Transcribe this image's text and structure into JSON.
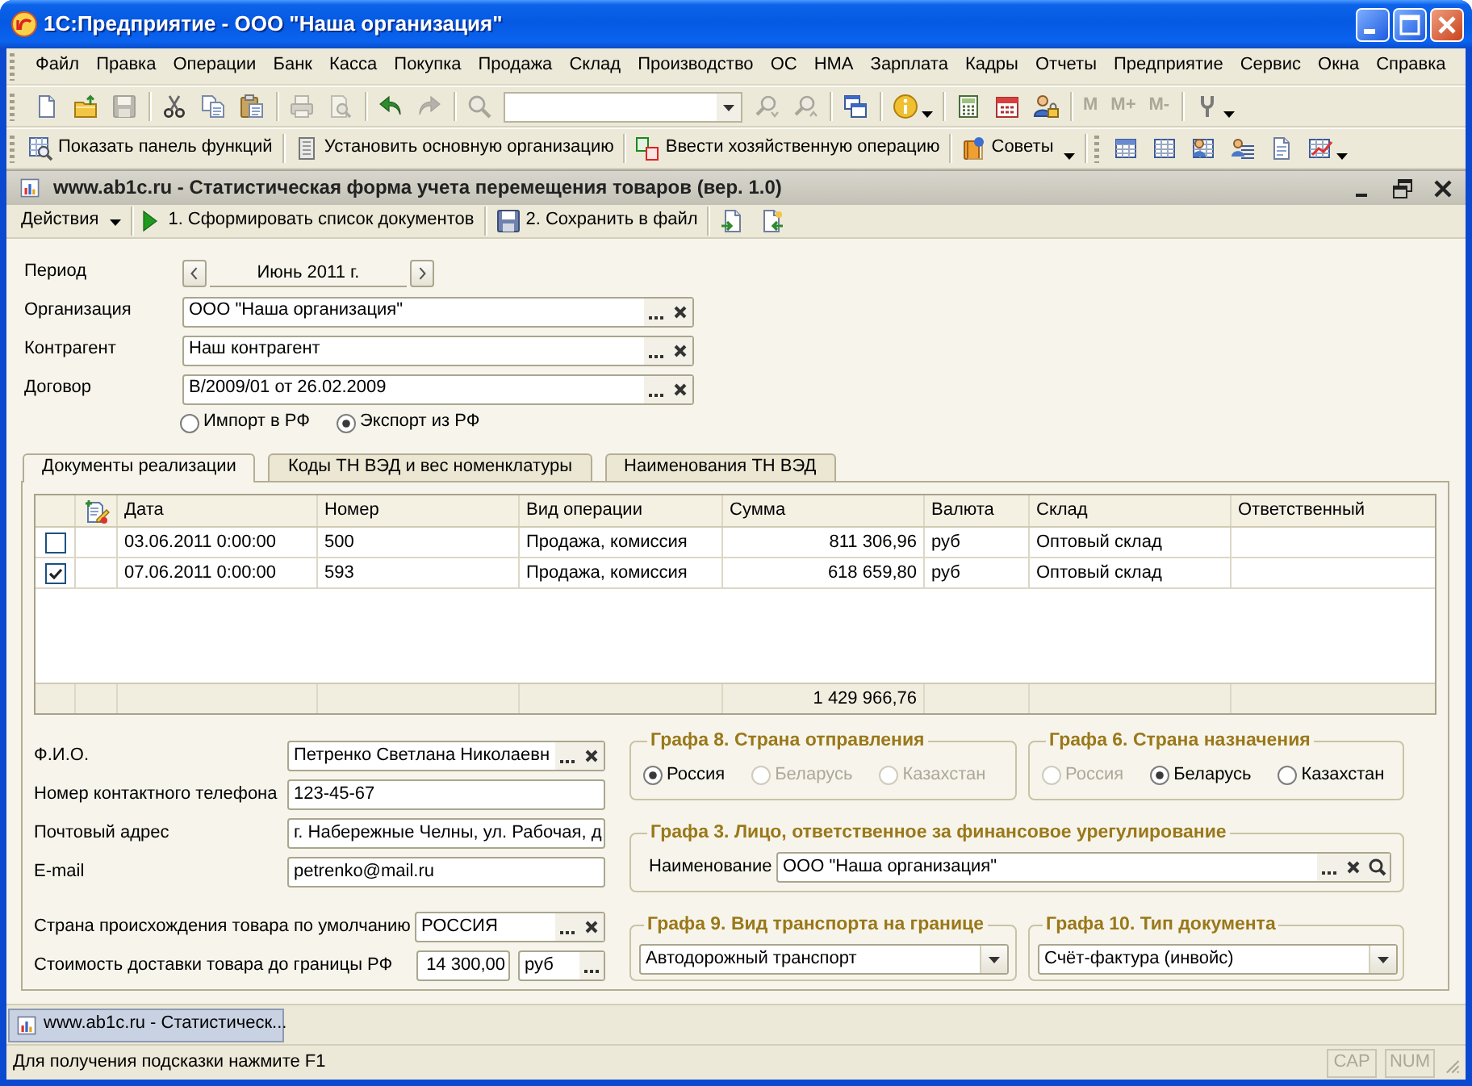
{
  "window": {
    "title": "1С:Предприятие - ООО \"Наша организация\""
  },
  "menu": [
    "Файл",
    "Правка",
    "Операции",
    "Банк",
    "Касса",
    "Покупка",
    "Продажа",
    "Склад",
    "Производство",
    "ОС",
    "НМА",
    "Зарплата",
    "Кадры",
    "Отчеты",
    "Предприятие",
    "Сервис",
    "Окна",
    "Справка"
  ],
  "toolbar": {
    "groups": [
      [
        {
          "kind": "icon",
          "disabled": false
        },
        {
          "kind": "icon",
          "disabled": false
        },
        {
          "kind": "icon",
          "disabled": true
        }
      ],
      [
        {
          "kind": "icon",
          "disabled": false
        },
        {
          "kind": "icon",
          "disabled": false
        },
        {
          "kind": "icon",
          "disabled": false
        }
      ],
      [
        {
          "kind": "icon",
          "disabled": true
        },
        {
          "kind": "icon",
          "disabled": true
        }
      ],
      [
        {
          "kind": "icon",
          "disabled": false
        },
        {
          "kind": "icon",
          "disabled": true
        }
      ],
      [
        {
          "kind": "icon",
          "disabled": true
        },
        {
          "kind": "combo"
        },
        {
          "kind": "icon",
          "disabled": true
        },
        {
          "kind": "icon",
          "disabled": true
        }
      ],
      [
        {
          "kind": "icon",
          "disabled": false
        }
      ],
      [
        {
          "kind": "icon",
          "disabled": false
        },
        {
          "kind": "caret"
        }
      ],
      [
        {
          "kind": "icon",
          "disabled": false
        },
        {
          "kind": "icon",
          "disabled": false
        },
        {
          "kind": "icon",
          "disabled": false
        }
      ],
      [
        {
          "kind": "text",
          "label": "M",
          "disabled": true
        },
        {
          "kind": "text",
          "label": "M+",
          "disabled": true
        },
        {
          "kind": "text",
          "label": "M-",
          "disabled": true
        }
      ],
      [
        {
          "kind": "icon",
          "disabled": false
        },
        {
          "kind": "caret"
        }
      ]
    ]
  },
  "functions_toolbar": [
    {
      "label": "Показать панель функций",
      "dropdown": false
    },
    {
      "label": "Установить основную организацию",
      "dropdown": false
    },
    {
      "label": "Ввести хозяйственную операцию",
      "dropdown": false
    },
    {
      "label": "Советы",
      "dropdown": true
    }
  ],
  "document_window": {
    "title": "www.ab1c.ru - Статистическая форма учета перемещения товаров (вер. 1.0)"
  },
  "form_toolbar": {
    "actions": "Действия",
    "buttons": [
      "1. Сформировать список документов",
      "2. Сохранить в файл"
    ]
  },
  "form": {
    "period": {
      "label": "Период",
      "value": "Июнь 2011 г."
    },
    "fields": [
      {
        "label": "Организация",
        "value": "ООО \"Наша организация\""
      },
      {
        "label": "Контрагент",
        "value": "Наш контрагент"
      },
      {
        "label": "Договор",
        "value": "В/2009/01 от 26.02.2009"
      }
    ],
    "direction": [
      {
        "label": "Импорт в РФ",
        "selected": false
      },
      {
        "label": "Экспорт из РФ",
        "selected": true
      }
    ]
  },
  "tabs": [
    {
      "label": "Документы реализации",
      "selected": true
    },
    {
      "label": "Коды ТН ВЭД и вес номенклатуры",
      "selected": false
    },
    {
      "label": "Наименования ТН ВЭД",
      "selected": false
    }
  ],
  "table": {
    "columns": [
      "Дата",
      "Номер",
      "Вид операции",
      "Сумма",
      "Валюта",
      "Склад",
      "Ответственный"
    ],
    "rows": [
      {
        "checked": false,
        "cells": [
          "03.06.2011 0:00:00",
          "500",
          "Продажа, комиссия",
          "811 306,96",
          "руб",
          "Оптовый склад"
        ]
      },
      {
        "checked": true,
        "cells": [
          "07.06.2011 0:00:00",
          "593",
          "Продажа, комиссия",
          "618 659,80",
          "руб",
          "Оптовый склад"
        ]
      }
    ],
    "total_amount": "1 429 966,76"
  },
  "contact": [
    {
      "label": "Ф.И.О.",
      "value": "Петренко Светлана Николаевн",
      "kind": "select"
    },
    {
      "label": "Номер контактного телефона",
      "value": "123-45-67",
      "kind": "text"
    },
    {
      "label": "Почтовый адрес",
      "value": "г. Набережные Челны, ул. Рабочая, д",
      "kind": "text"
    },
    {
      "label": "E-mail",
      "value": "petrenko@mail.ru",
      "kind": "text"
    }
  ],
  "origin_country": {
    "label": "Страна происхождения товара по умолчанию",
    "value": "РОССИЯ"
  },
  "delivery_cost": {
    "label": "Стоимость доставки товара до границы РФ",
    "value": "14 300,00",
    "currency": "руб"
  },
  "departure_country": {
    "title": "Графа 8. Страна отправления",
    "options": [
      {
        "label": "Россия",
        "selected": true,
        "disabled": false
      },
      {
        "label": "Беларусь",
        "selected": false,
        "disabled": true
      },
      {
        "label": "Казахстан",
        "selected": false,
        "disabled": true
      }
    ]
  },
  "destination_country": {
    "title": "Графа 6. Страна назначения",
    "options": [
      {
        "label": "Россия",
        "selected": false,
        "disabled": true
      },
      {
        "label": "Беларусь",
        "selected": true,
        "disabled": false
      },
      {
        "label": "Казахстан",
        "selected": false,
        "disabled": false
      }
    ]
  },
  "financial_party": {
    "title": "Графа 3. Лицо, ответственное за финансовое урегулирование",
    "label": "Наименование",
    "value": "ООО \"Наша организация\""
  },
  "transport": {
    "title": "Графа 9. Вид транспорта на границе",
    "value": "Автодорожный транспорт"
  },
  "document_type": {
    "title": "Графа 10. Тип документа",
    "value": "Счёт-фактура (инвойс)"
  },
  "taskbar": [
    {
      "label": "www.ab1c.ru - Статистическ...",
      "selected": true
    }
  ],
  "status_bar": {
    "text": "Для получения подсказки нажмите F1",
    "indicators": [
      {
        "label": "CAP",
        "on": false
      },
      {
        "label": "NUM",
        "on": false
      }
    ]
  }
}
